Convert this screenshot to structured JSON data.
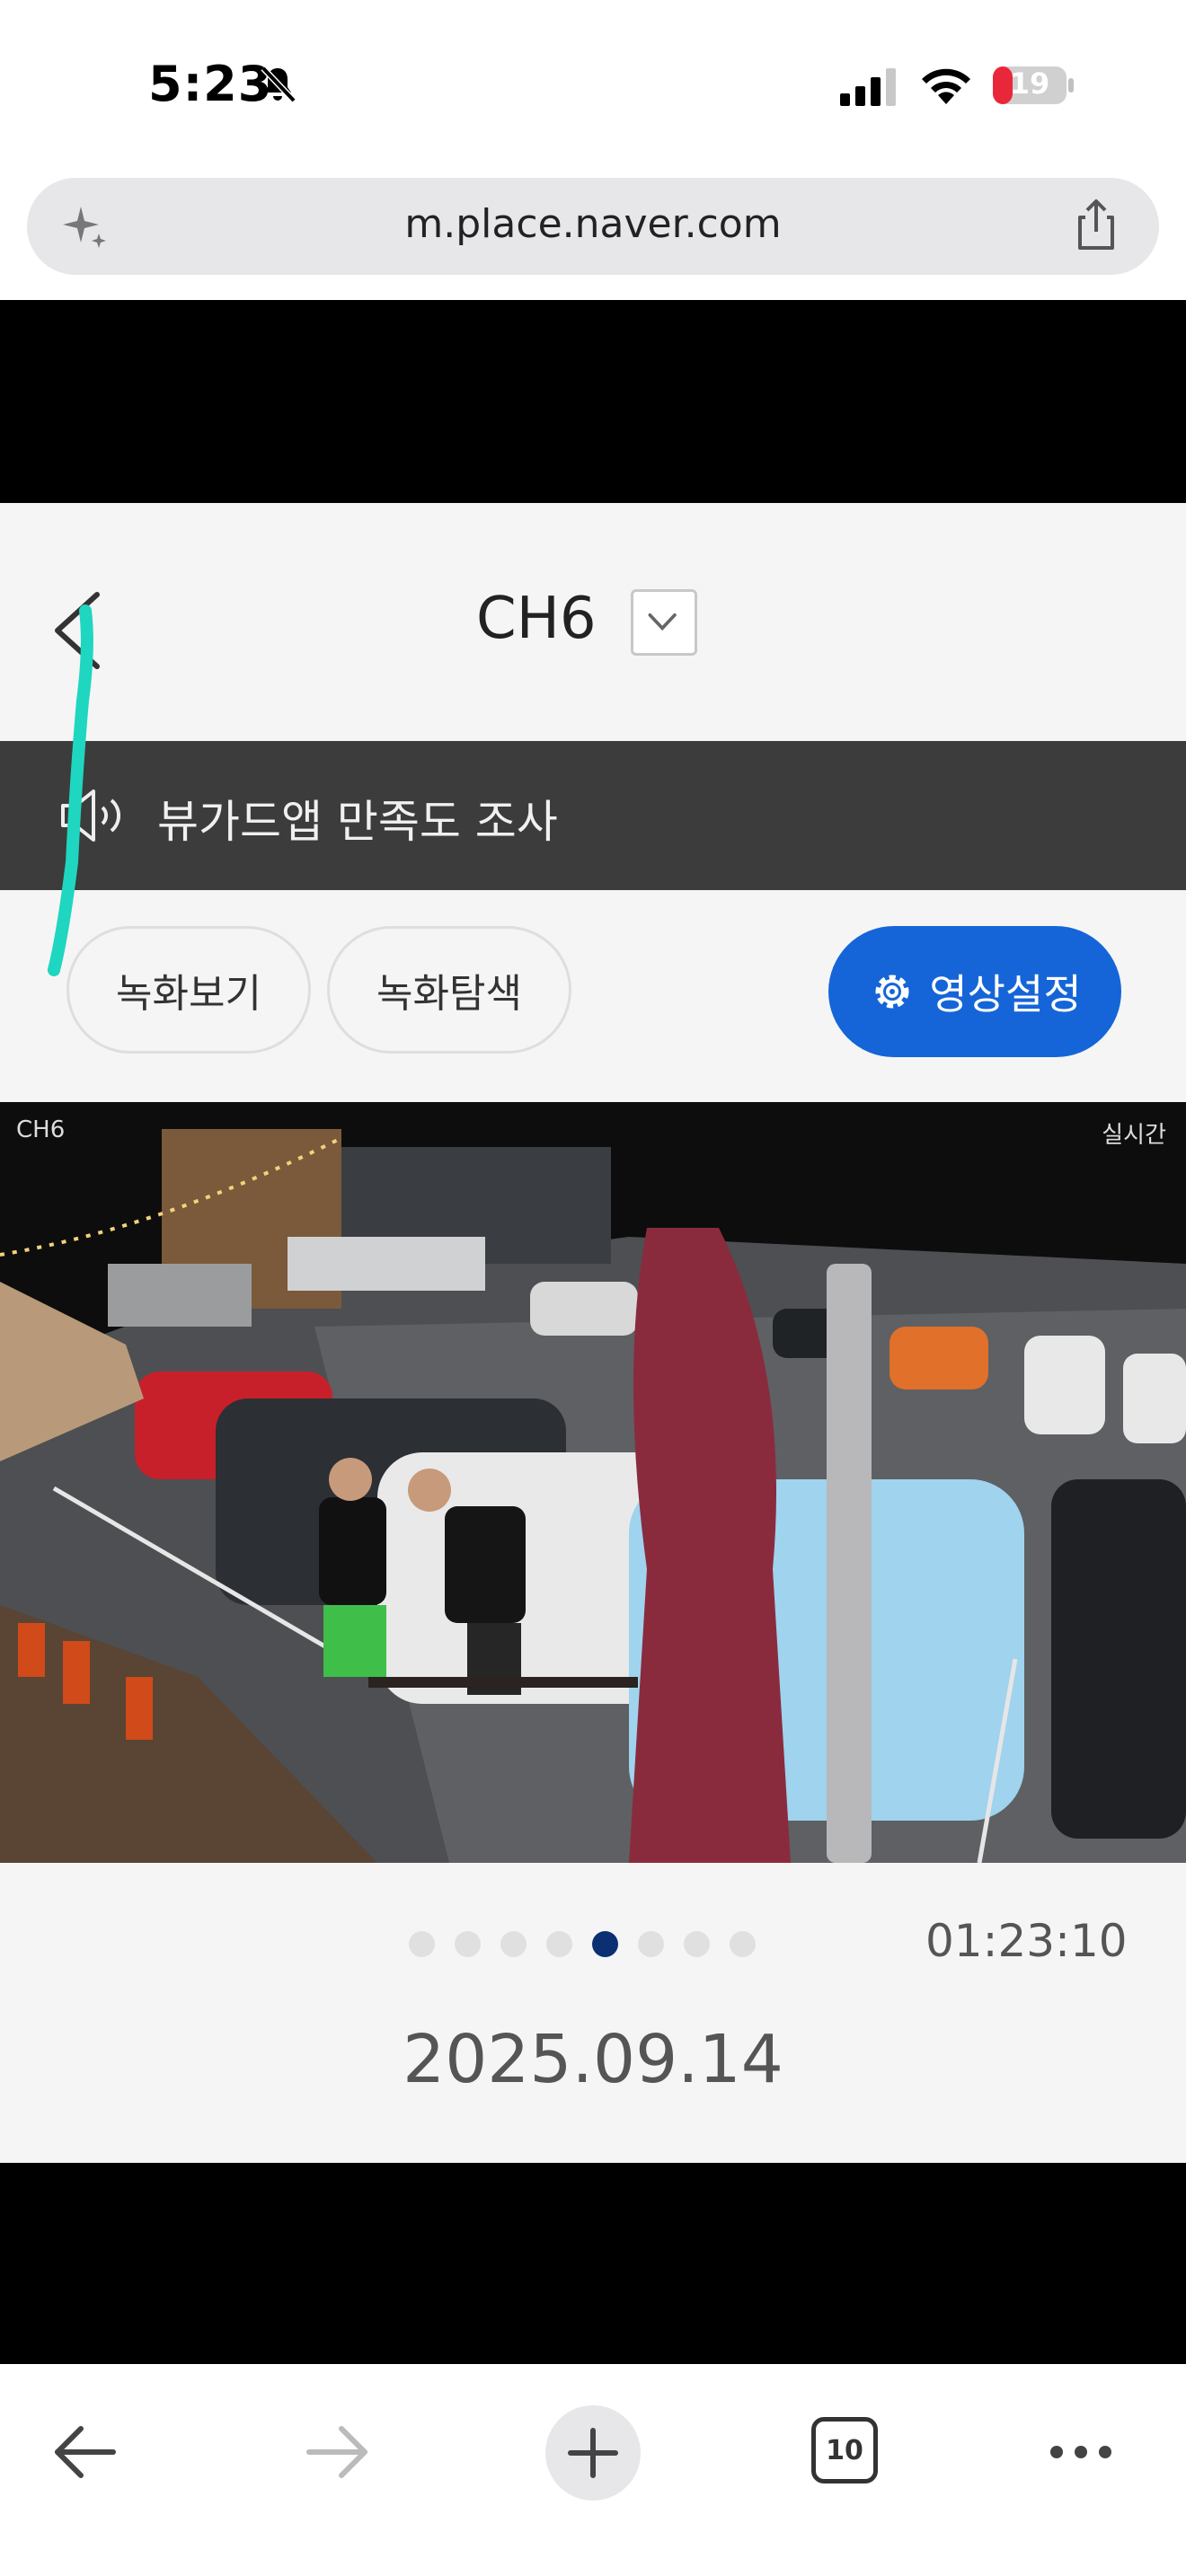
{
  "status_bar": {
    "time": "5:23",
    "battery": "19",
    "icons": [
      "bell-off-icon",
      "signal-icon",
      "wifi-icon",
      "battery-icon"
    ]
  },
  "browser": {
    "url": "m.place.naver.com",
    "tab_count": "10",
    "toolbar_icons": [
      "back-arrow-icon",
      "forward-arrow-icon",
      "plus-icon",
      "tabs-icon",
      "more-icon"
    ]
  },
  "header": {
    "channel": "CH6"
  },
  "survey_banner": {
    "text": "뷰가드앱 만족도 조사"
  },
  "buttons": {
    "record_view": "녹화보기",
    "record_search": "녹화탐색",
    "video_settings": "영상설정"
  },
  "camera": {
    "channel_label": "CH6",
    "live_label": "실시간"
  },
  "pager": {
    "total": 8,
    "active_index": 4
  },
  "playback": {
    "time": "01:23:10",
    "date": "2025.09.14"
  },
  "colors": {
    "accent_blue": "#1565d8",
    "banner_dark": "#3c3c3c",
    "active_dot": "#0b2f73",
    "highlight_stroke": "#1fd6c0"
  }
}
